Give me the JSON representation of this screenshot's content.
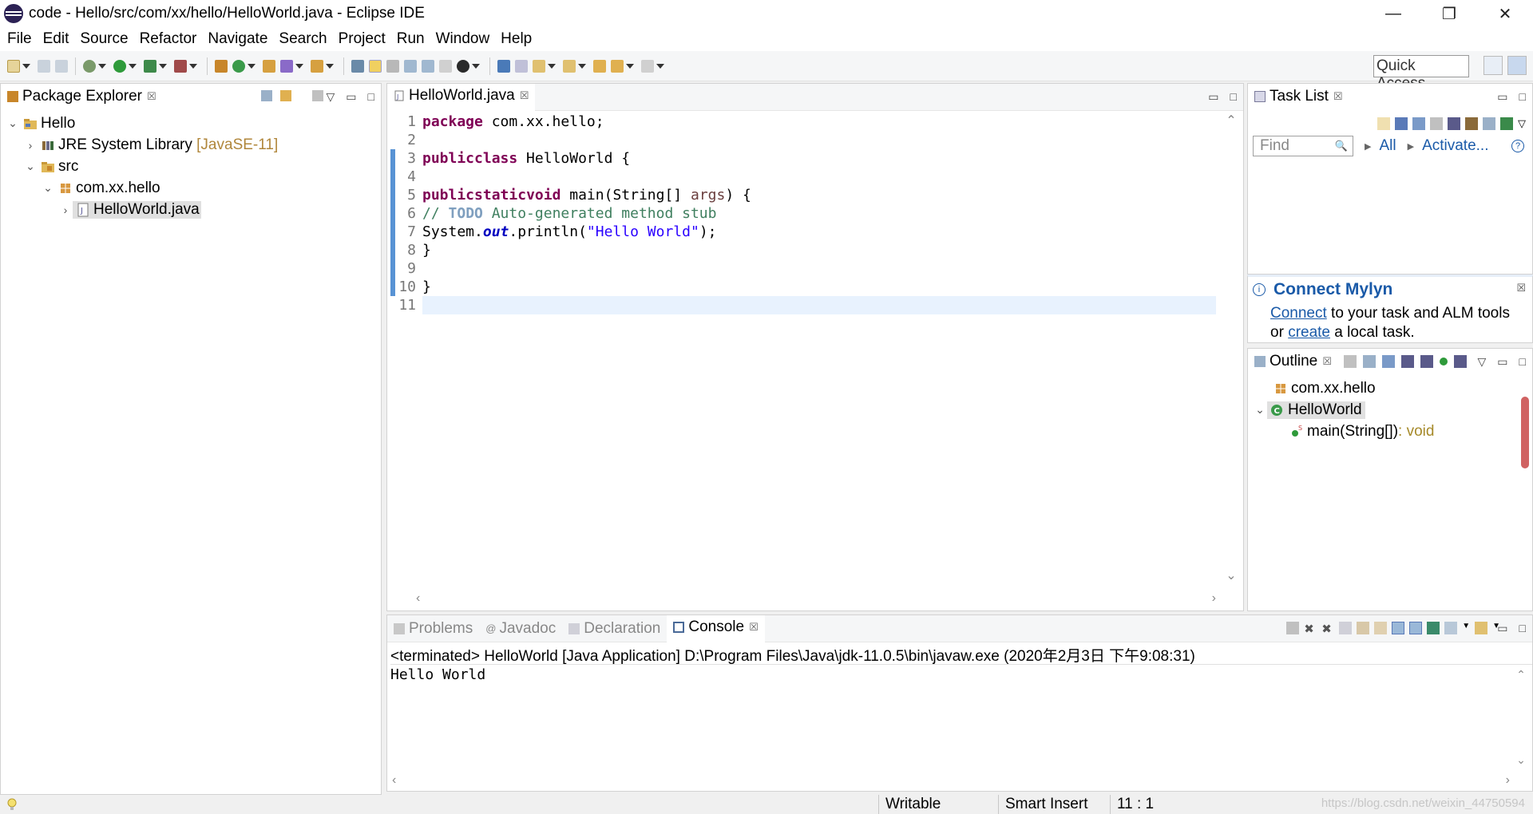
{
  "window": {
    "title": "code - Hello/src/com/xx/hello/HelloWorld.java - Eclipse IDE",
    "minimize": "—",
    "restore": "❐",
    "close": "✕"
  },
  "menu": [
    "File",
    "Edit",
    "Source",
    "Refactor",
    "Navigate",
    "Search",
    "Project",
    "Run",
    "Window",
    "Help"
  ],
  "toolbar": {
    "quick_access": "Quick Access"
  },
  "package_explorer": {
    "tab": "Package Explorer",
    "close": "☒",
    "tree": {
      "project": "Hello",
      "jre": "JRE System Library",
      "jre_version": "[JavaSE-11]",
      "src": "src",
      "package": "com.xx.hello",
      "file": "HelloWorld.java"
    }
  },
  "editor": {
    "tab": "HelloWorld.java",
    "close": "☒",
    "lines": {
      "n1": "1",
      "n2": "2",
      "n3": "3",
      "n4": "4",
      "n5": "5",
      "n6": "6",
      "n7": "7",
      "n8": "8",
      "n9": "9",
      "n10": "10",
      "n11": "11",
      "l1_kw": "package",
      "l1_rest": " com.xx.hello;",
      "l3_kw1": "public",
      "l3_kw2": "class",
      "l3_rest": " HelloWorld {",
      "l5_kw1": "public",
      "l5_kw2": "static",
      "l5_kw3": "void",
      "l5_mid": " main(String[] ",
      "l5_args": "args",
      "l5_end": ") {",
      "l6_pre": "// ",
      "l6_todo": "TODO",
      "l6_rest": " Auto-generated method stub",
      "l7_pre": "System.",
      "l7_out": "out",
      "l7_mid": ".println(",
      "l7_str": "\"Hello World\"",
      "l7_end": ");",
      "l8": "}",
      "l10": "}"
    }
  },
  "task_list": {
    "tab": "Task List",
    "close": "☒",
    "find_placeholder": "Find",
    "all": "All",
    "activate": "Activate...",
    "help": "?"
  },
  "mylyn": {
    "title": "Connect Mylyn",
    "close": "☒",
    "connect": "Connect",
    "text1": " to your task and ALM tools",
    "text2": "or ",
    "create": "create",
    "text3": " a local task."
  },
  "outline": {
    "tab": "Outline",
    "close": "☒",
    "package": "com.xx.hello",
    "class": "HelloWorld",
    "method": "main(String[])",
    "method_type": " : void"
  },
  "bottom_tabs": {
    "problems": "Problems",
    "javadoc": "Javadoc",
    "declaration": "Declaration",
    "console": "Console",
    "close": "☒"
  },
  "console": {
    "header": "<terminated> HelloWorld [Java Application] D:\\Program Files\\Java\\jdk-11.0.5\\bin\\javaw.exe (2020年2月3日 下午9:08:31)",
    "output": "Hello World"
  },
  "status": {
    "writable": "Writable",
    "insert": "Smart Insert",
    "position": "11 : 1",
    "watermark": "https://blog.csdn.net/weixin_44750594"
  },
  "colors": {
    "keyword": "#7f0055",
    "comment": "#3f7f5f",
    "string": "#2a00ff",
    "link": "#1a5aa8"
  }
}
